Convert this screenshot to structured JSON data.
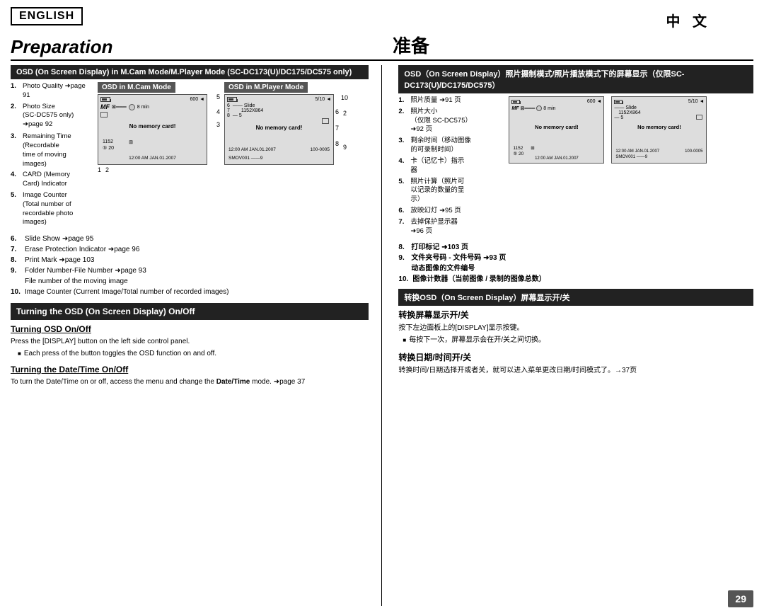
{
  "page": {
    "page_number": "29"
  },
  "header": {
    "english_label": "ENGLISH",
    "chinese_label": "中  文",
    "prep_en": "Preparation",
    "prep_zh": "准备"
  },
  "left_section": {
    "osd_header": "OSD (On Screen Display) in M.Cam Mode/M.Player Mode (SC-DC173(U)/DC175/DC575 only)",
    "cam_mode_label": "OSD in M.Cam Mode",
    "player_mode_label": "OSD in M.Player Mode",
    "cam_numbers_right": [
      "5",
      "4",
      "3"
    ],
    "cam_numbers_left": [
      "1",
      "2"
    ],
    "player_numbers_right": [
      "10",
      "2",
      "9"
    ],
    "player_numbers_left": [
      "6",
      "7",
      "8"
    ],
    "lcd_cam": {
      "mf": "MF",
      "value600": "600",
      "time": "8 min",
      "no_memory": "No memory card!",
      "resolution": "1152",
      "count": "20",
      "date": "12:00 AM JAN.01.2007"
    },
    "lcd_player": {
      "fraction": "5/10",
      "slide": "Slide",
      "resolution": "1152X864",
      "count": "5",
      "no_memory": "No memory card!",
      "date": "12:00 AM JAN.01.2007",
      "file_num": "100-0005",
      "smov": "SMOV001"
    },
    "items": [
      {
        "num": "1.",
        "text": "Photo Quality →page 91"
      },
      {
        "num": "2.",
        "text": "Photo Size\n(SC-DC575 only)\n→page 92"
      },
      {
        "num": "3.",
        "text": "Remaining Time\n(Recordable\ntime of moving\nimages)"
      },
      {
        "num": "4.",
        "text": "CARD (Memory\nCard) Indicator"
      },
      {
        "num": "5.",
        "text": "Image Counter\n(Total number of\nrecordable photo\nimages)"
      },
      {
        "num": "6.",
        "text": "Slide Show →page 95"
      },
      {
        "num": "7.",
        "text": "Erase Protection Indicator →page 96"
      },
      {
        "num": "8.",
        "text": "Print Mark →page 103"
      },
      {
        "num": "9.",
        "text": "Folder Number-File Number →page 93\nFile number of the moving image"
      },
      {
        "num": "10.",
        "text": "Image Counter (Current Image/Total number of recorded images)"
      }
    ],
    "turning_header": "Turning the OSD (On Screen Display) On/Off",
    "subsec1_title": "Turning OSD On/Off",
    "subsec1_body": "Press the [DISPLAY] button on the left side control panel.",
    "subsec1_bullet": "Each press of the button toggles the OSD function on and off.",
    "subsec2_title": "Turning the Date/Time On/Off",
    "subsec2_body": "To turn the Date/Time on or off, access the menu and change the Date/Time mode. →page 37"
  },
  "right_section": {
    "osd_header_zh": "OSD（On Screen Display）照片摄制模式/照片播放模式下的屏幕显示（仅限SC-DC173(U)/DC175/DC575）",
    "items_right": [
      {
        "num": "1.",
        "text": "照片质量 →91 页"
      },
      {
        "num": "2.",
        "text": "照片大小\n（仅限 SC-DC575）\n→92 页"
      },
      {
        "num": "3.",
        "text": "剩余时间（移动图像\n的可录制时间）"
      },
      {
        "num": "4.",
        "text": "卡（记忆卡）指示\n器"
      },
      {
        "num": "5.",
        "text": "照片计算（照片可\n以记录的数量的显\n示）"
      },
      {
        "num": "6.",
        "text": "放映幻灯 →95 页"
      },
      {
        "num": "7.",
        "text": "去掉保护显示器\n→96 页"
      }
    ],
    "items_right2": [
      {
        "num": "8.",
        "text": "打印标记 →103 页"
      },
      {
        "num": "9.",
        "text": "文件夹号码 - 文件号码 →93 页\n动态图像的文件编号"
      },
      {
        "num": "10.",
        "text": "图像计数器（当前图像 / 录制的图像总数）"
      }
    ],
    "turning_header_zh": "转换OSD（On Screen Display）屏幕显示开/关",
    "subsec1_title_zh": "转换屏幕显示开/关",
    "subsec1_body_zh": "按下左边面板上的[DISPLAY]显示按键。",
    "subsec1_bullet_zh": "每按下一次，屏幕显示会在开/关之间切换。",
    "subsec2_title_zh": "转换日期/时间开/关",
    "subsec2_body_zh": "转换时间/日期选择开或者关，就可以进入菜单更改日期/时间模式了。→37页"
  }
}
